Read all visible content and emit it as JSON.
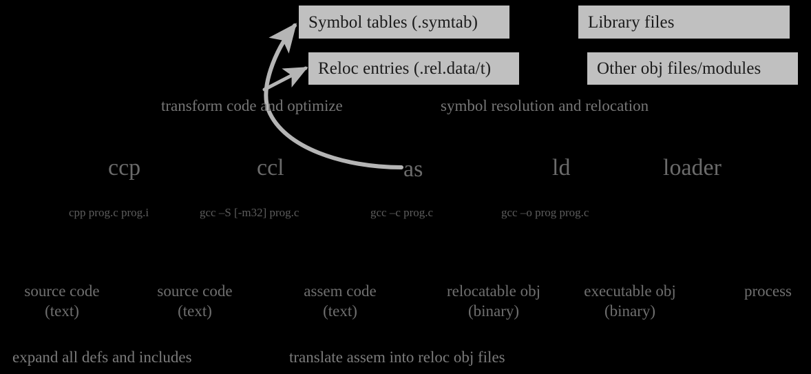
{
  "diagram": {
    "title": "C compilation pipeline",
    "background_color": "#000000",
    "box_fill_color": "#c0c0c0",
    "box_text_color": "#1a1a1a",
    "label_text_color": "#6f6f6f",
    "arrow_color": "#b5b5b5"
  },
  "boxes": [
    {
      "id": "symtab",
      "label": "Symbol tables (.symtab)"
    },
    {
      "id": "reloc",
      "label": "Reloc entries (.rel.data/t)"
    },
    {
      "id": "library",
      "label": "Library files"
    },
    {
      "id": "otherobj",
      "label": "Other obj files/modules"
    }
  ],
  "phase_descriptions": [
    {
      "id": "transform",
      "label": "transform code and optimize"
    },
    {
      "id": "symres",
      "label": "symbol resolution and relocation"
    }
  ],
  "stages": [
    {
      "id": "ccp",
      "label": "ccp"
    },
    {
      "id": "ccl",
      "label": "ccl"
    },
    {
      "id": "as",
      "label": "as"
    },
    {
      "id": "ld",
      "label": "ld"
    },
    {
      "id": "loader",
      "label": "loader"
    }
  ],
  "commands": [
    {
      "id": "cpp",
      "label": "cpp prog.c prog.i"
    },
    {
      "id": "gccS",
      "label": "gcc –S [-m32] prog.c"
    },
    {
      "id": "gccc",
      "label": "gcc –c  prog.c"
    },
    {
      "id": "gcco",
      "label": "gcc –o prog  prog.c"
    }
  ],
  "artifacts": [
    {
      "id": "a1",
      "line1": "source code",
      "line2": "(text)"
    },
    {
      "id": "a2",
      "line1": "source code",
      "line2": "(text)"
    },
    {
      "id": "a3",
      "line1": "assem code",
      "line2": "(text)"
    },
    {
      "id": "a4",
      "line1": "relocatable obj",
      "line2": "(binary)"
    },
    {
      "id": "a5",
      "line1": "executable obj",
      "line2": "(binary)"
    },
    {
      "id": "a6",
      "line1": "process",
      "line2": ""
    }
  ],
  "notes": [
    {
      "id": "expand",
      "label": "expand all defs and includes"
    },
    {
      "id": "translate",
      "label": "translate assem into reloc obj files"
    }
  ]
}
